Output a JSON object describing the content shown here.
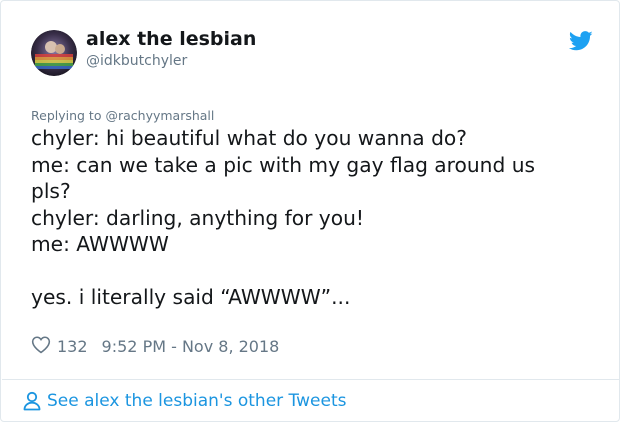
{
  "author": {
    "name": "alex the lesbian",
    "handle": "@idkbutchyler",
    "avatar_icon": "profile-photo"
  },
  "brand": {
    "icon": "twitter-bird-icon",
    "color": "#1da1f2"
  },
  "tweet": {
    "replying_prefix": "Replying to",
    "replying_to": "@rachyymarshall",
    "lines": [
      "chyler: hi beautiful what do you wanna do?",
      "me: can we take a pic with my gay flag around us",
      "pls?",
      "chyler: darling, anything for you!",
      "me: AWWWW",
      "",
      "yes. i literally said “AWWWW”..."
    ],
    "likes": "132",
    "timestamp": "9:52 PM - Nov 8, 2018"
  },
  "footer": {
    "link_text": "See alex the lesbian's other Tweets",
    "icon": "person-icon",
    "color": "#1b95e0"
  }
}
